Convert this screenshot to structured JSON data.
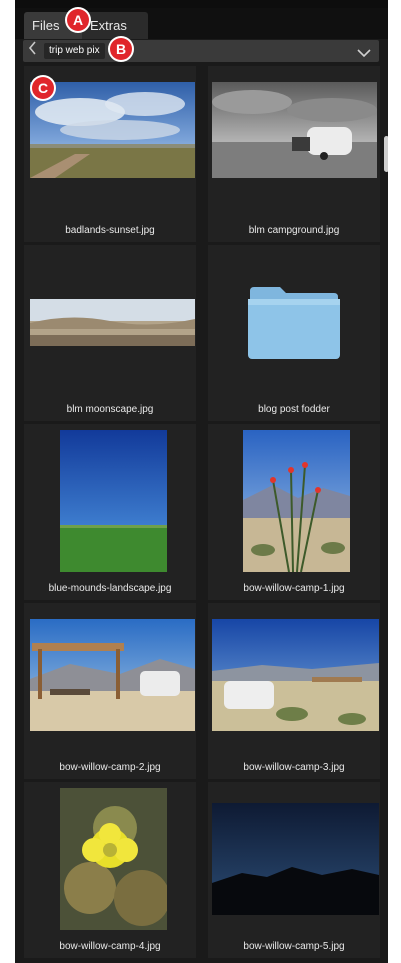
{
  "tabs": [
    {
      "label": "Files"
    },
    {
      "label": "Extras"
    }
  ],
  "path": {
    "label": "trip web pix"
  },
  "badges": {
    "a": "A",
    "b": "B",
    "c": "C"
  },
  "items": [
    {
      "name": "badlands-sunset.jpg",
      "kind": "image"
    },
    {
      "name": "blm campground.jpg",
      "kind": "image"
    },
    {
      "name": "blm moonscape.jpg",
      "kind": "image"
    },
    {
      "name": "blog post fodder",
      "kind": "folder"
    },
    {
      "name": "blue-mounds-landscape.jpg",
      "kind": "image"
    },
    {
      "name": "bow-willow-camp-1.jpg",
      "kind": "image"
    },
    {
      "name": "bow-willow-camp-2.jpg",
      "kind": "image"
    },
    {
      "name": "bow-willow-camp-3.jpg",
      "kind": "image"
    },
    {
      "name": "bow-willow-camp-4.jpg",
      "kind": "image"
    },
    {
      "name": "bow-willow-camp-5.jpg",
      "kind": "image"
    }
  ],
  "icons": {
    "back": "chevron-left-icon",
    "dropdown": "chevron-down-icon",
    "folder": "folder-icon"
  },
  "colors": {
    "panel": "#1a1a1a",
    "cell": "#222222",
    "badge": "#e0262b",
    "folder": "#8ec4e8"
  }
}
